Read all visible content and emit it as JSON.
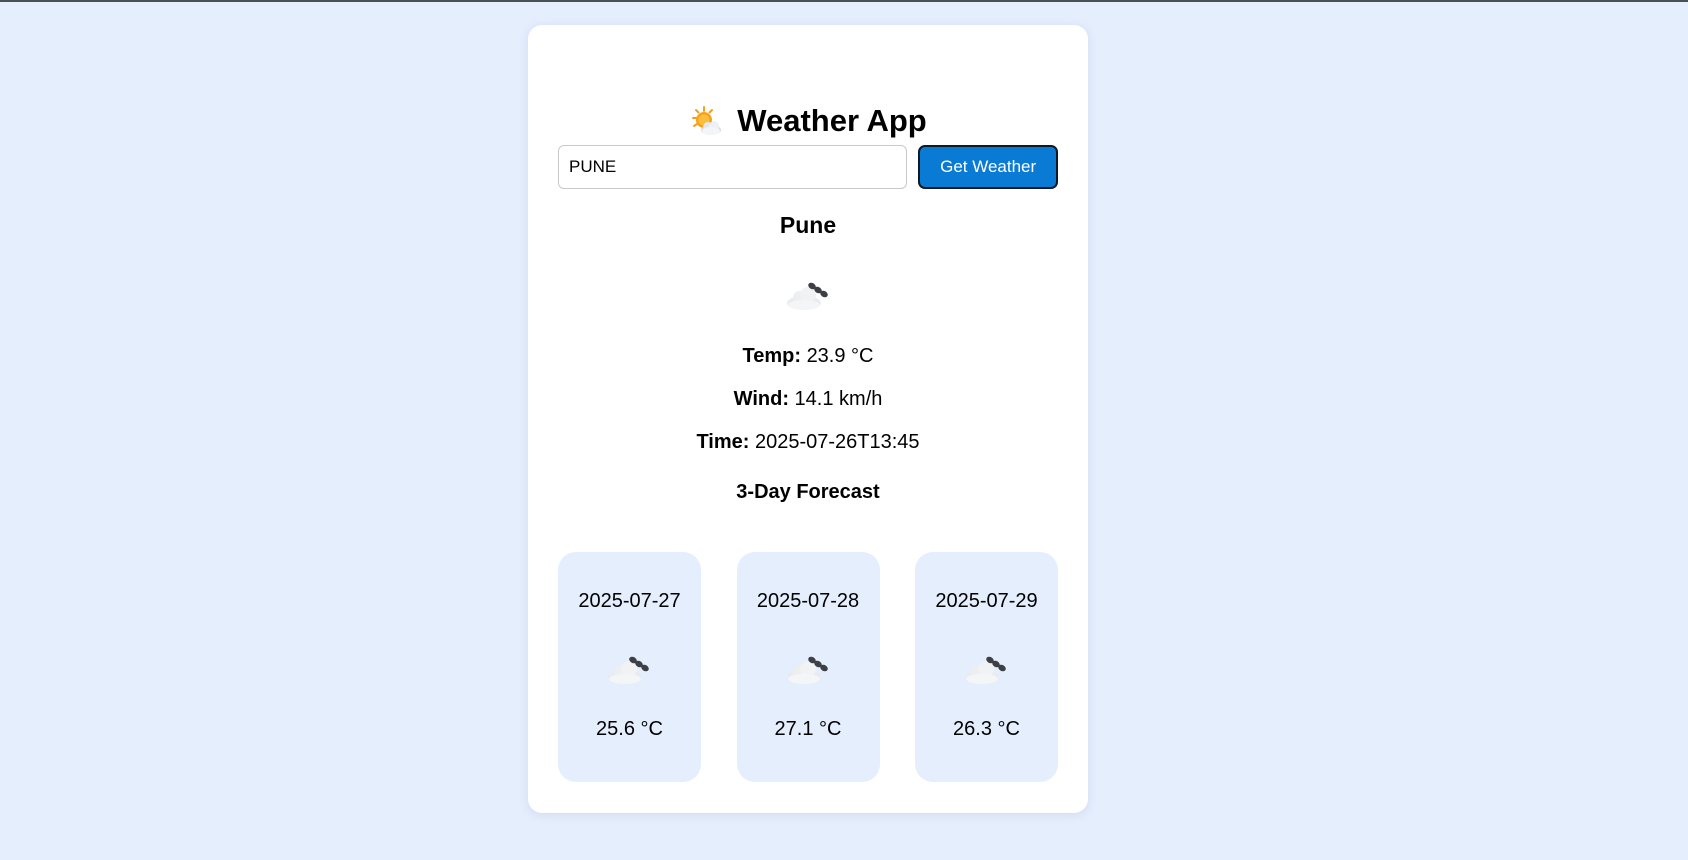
{
  "app": {
    "title": "Weather App",
    "title_icon": "sun-behind-cloud-icon"
  },
  "search": {
    "value": "PUNE",
    "button_label": "Get Weather"
  },
  "current": {
    "city": "Pune",
    "icon": "cloud-with-rain-drops-icon",
    "temp_label": "Temp:",
    "temp_value": "23.9 °C",
    "wind_label": "Wind:",
    "wind_value": "14.1 km/h",
    "time_label": "Time:",
    "time_value": "2025-07-26T13:45"
  },
  "forecast": {
    "title": "3-Day Forecast",
    "days": [
      {
        "date": "2025-07-27",
        "icon": "cloud-with-rain-drops-icon",
        "temp": "25.6 °C"
      },
      {
        "date": "2025-07-28",
        "icon": "cloud-with-rain-drops-icon",
        "temp": "27.1 °C"
      },
      {
        "date": "2025-07-29",
        "icon": "cloud-with-rain-drops-icon",
        "temp": "26.3 °C"
      }
    ]
  },
  "colors": {
    "background": "#e5eefd",
    "card": "#ffffff",
    "button": "#0a7bd4",
    "forecast_card": "#e5eefd"
  }
}
